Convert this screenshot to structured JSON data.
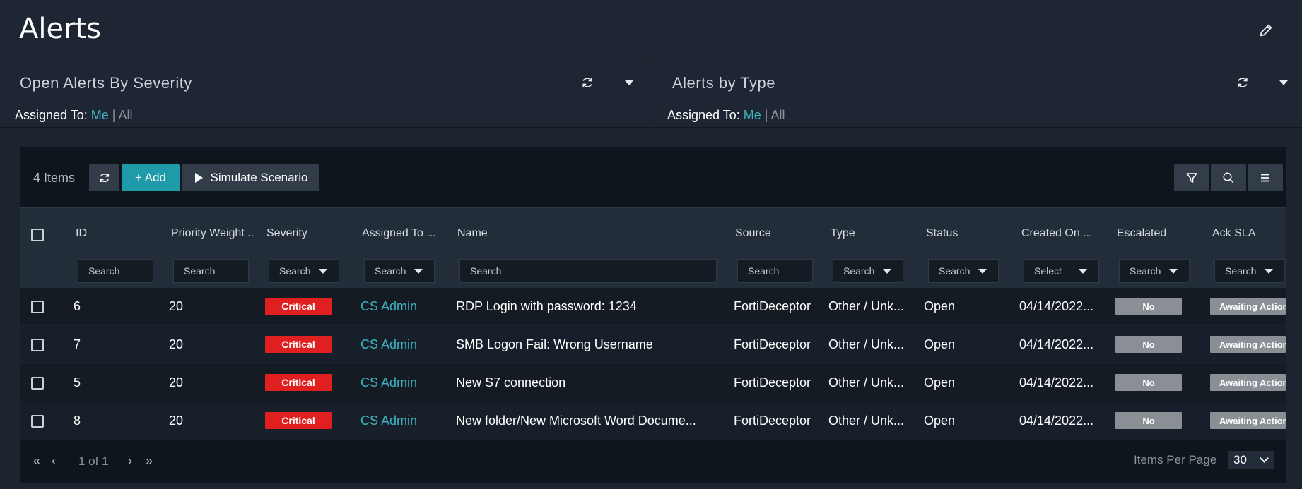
{
  "page": {
    "title": "Alerts"
  },
  "widgets": [
    {
      "title": "Open Alerts By Severity",
      "assigned_label": "Assigned To:",
      "me": "Me",
      "sep": "|",
      "all": "All"
    },
    {
      "title": "Alerts by Type",
      "assigned_label": "Assigned To:",
      "me": "Me",
      "sep": "|",
      "all": "All"
    }
  ],
  "toolbar": {
    "items_count": "4 Items",
    "add_label": "+ Add",
    "simulate_label": "Simulate Scenario"
  },
  "columns": [
    {
      "label": "ID",
      "filter": "Search",
      "filter_type": "input"
    },
    {
      "label": "Priority Weight ..",
      "filter": "Search",
      "filter_type": "input"
    },
    {
      "label": "Severity",
      "filter": "Search",
      "filter_type": "select"
    },
    {
      "label": "Assigned To  ...",
      "filter": "Search",
      "filter_type": "select"
    },
    {
      "label": "Name",
      "filter": "Search",
      "filter_type": "input"
    },
    {
      "label": "Source",
      "filter": "Search",
      "filter_type": "input"
    },
    {
      "label": "Type",
      "filter": "Search",
      "filter_type": "select"
    },
    {
      "label": "Status",
      "filter": "Search",
      "filter_type": "select"
    },
    {
      "label": "Created On  ...",
      "filter": "Select",
      "filter_type": "select"
    },
    {
      "label": "Escalated",
      "filter": "Search",
      "filter_type": "select"
    },
    {
      "label": "Ack SLA",
      "filter": "Search",
      "filter_type": "select"
    }
  ],
  "rows": [
    {
      "id": "6",
      "priority": "20",
      "severity": "Critical",
      "assigned": "CS Admin",
      "name": "RDP Login with password: 1234",
      "source": "FortiDeceptor",
      "type": "Other / Unk...",
      "status": "Open",
      "created": "04/14/2022...",
      "escalated": "No",
      "ack_sla": "Awaiting Action"
    },
    {
      "id": "7",
      "priority": "20",
      "severity": "Critical",
      "assigned": "CS Admin",
      "name": "SMB Logon Fail: Wrong Username",
      "source": "FortiDeceptor",
      "type": "Other / Unk...",
      "status": "Open",
      "created": "04/14/2022...",
      "escalated": "No",
      "ack_sla": "Awaiting Action"
    },
    {
      "id": "5",
      "priority": "20",
      "severity": "Critical",
      "assigned": "CS Admin",
      "name": "New S7 connection",
      "source": "FortiDeceptor",
      "type": "Other / Unk...",
      "status": "Open",
      "created": "04/14/2022...",
      "escalated": "No",
      "ack_sla": "Awaiting Action"
    },
    {
      "id": "8",
      "priority": "20",
      "severity": "Critical",
      "assigned": "CS Admin",
      "name": "New folder/New Microsoft Word Docume...",
      "source": "FortiDeceptor",
      "type": "Other / Unk...",
      "status": "Open",
      "created": "04/14/2022...",
      "escalated": "No",
      "ack_sla": "Awaiting Action"
    }
  ],
  "pagination": {
    "page_text": "1 of 1",
    "items_per_page_label": "Items Per Page",
    "items_per_page": "30"
  },
  "colors": {
    "accent": "#1f9aa8",
    "link": "#3fb3c1",
    "critical": "#e02020",
    "grey_badge": "#8a8f96"
  }
}
